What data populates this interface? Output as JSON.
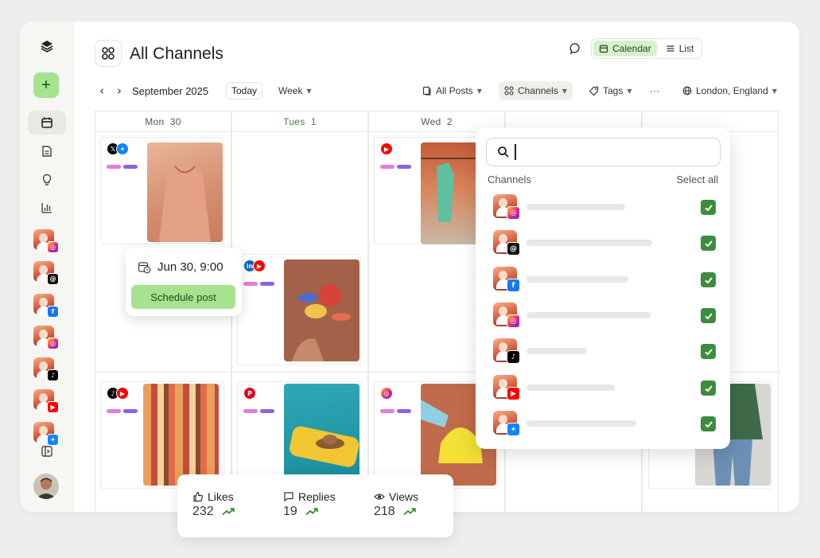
{
  "header": {
    "title": "All Channels",
    "views": [
      {
        "label": "Calendar",
        "active": true
      },
      {
        "label": "List",
        "active": false
      }
    ]
  },
  "toolbar": {
    "period": "September 2025",
    "today_label": "Today",
    "range_label": "Week",
    "filters": [
      "All Posts",
      "Channels",
      "Tags"
    ],
    "more_label": "···",
    "timezone": "London, England"
  },
  "calendar": {
    "days": [
      {
        "name": "Mon",
        "num": "30",
        "today": false
      },
      {
        "name": "Tues",
        "num": "1",
        "today": true
      },
      {
        "name": "Wed",
        "num": "2",
        "today": false
      }
    ]
  },
  "schedule_popup": {
    "date": "Jun 30, 9:00",
    "button": "Schedule post"
  },
  "channels_panel": {
    "search_placeholder": "",
    "title": "Channels",
    "select_all": "Select all",
    "items": [
      {
        "network": "instagram",
        "checked": true
      },
      {
        "network": "threads",
        "checked": true
      },
      {
        "network": "facebook",
        "checked": true
      },
      {
        "network": "instagram",
        "checked": true
      },
      {
        "network": "tiktok",
        "checked": true
      },
      {
        "network": "youtube",
        "checked": true
      },
      {
        "network": "bluesky",
        "checked": true
      }
    ]
  },
  "sidebar": {
    "nav": [
      "calendar-icon",
      "document-icon",
      "lightbulb-icon",
      "analytics-icon"
    ],
    "channels": [
      "instagram",
      "threads",
      "facebook",
      "instagram",
      "tiktok",
      "youtube",
      "bluesky"
    ]
  },
  "stats": {
    "likes_label": "Likes",
    "likes_value": "232",
    "replies_label": "Replies",
    "replies_value": "19",
    "views_label": "Views",
    "views_value": "218"
  },
  "colors": {
    "accent_green": "#a6e38f",
    "today_green": "#3a8a2f",
    "check_green": "#3d8c40"
  }
}
